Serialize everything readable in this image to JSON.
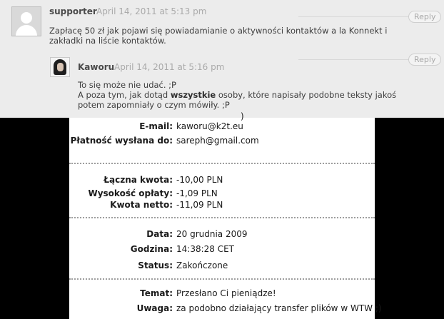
{
  "comments": [
    {
      "author": "supporter",
      "date": "April 14, 2011 at 5:13 pm",
      "text": "Zapłacę 50 zł jak pojawi się powiadamianie o aktywności kontaktów a la Konnekt i zakładki na liście kontaktów.",
      "reply_label": "Reply",
      "avatar_icon": "default-avatar-icon"
    },
    {
      "author": "Kaworu",
      "date": "April 14, 2011 at 5:16 pm",
      "text_line1": "To się może nie udać. ;P",
      "text_line2_before": "A poza tym, jak dotąd ",
      "text_line2_bold": "wszystkie",
      "text_line2_after": " osoby, które napisały podobne teksty jakoś potem zapomniały o czym mówiły. ;P",
      "reply_label": "Reply",
      "avatar_icon": "user-photo-icon"
    }
  ],
  "receipt": {
    "cut_top_text": ")",
    "contact": [
      {
        "label": "E-mail:",
        "value": "kaworu@k2t.eu"
      },
      {
        "label": "Płatność wysłana do:",
        "value": "sareph@gmail.com"
      }
    ],
    "amounts": [
      {
        "label": "Łączna kwota:",
        "value": "-10,00 PLN"
      },
      {
        "label": "Wysokość opłaty:",
        "value": "-1,09 PLN"
      },
      {
        "label": "Kwota netto:",
        "value": "-11,09 PLN"
      }
    ],
    "timing": [
      {
        "label": "Data:",
        "value": "20 grudnia 2009"
      },
      {
        "label": "Godzina:",
        "value": "14:38:28 CET"
      },
      {
        "label": "Status:",
        "value": "Zakończone"
      }
    ],
    "message": [
      {
        "label": "Temat:",
        "value": "Przesłano Ci pieniądze!"
      },
      {
        "label": "Uwaga:",
        "value": "za podobno działający transfer plików w WTW ;)"
      }
    ]
  },
  "colors": {
    "comment_bg": "#ececec",
    "page_bg": "#000000",
    "receipt_bg": "#ffffff",
    "date_text": "#aaaaaa"
  }
}
